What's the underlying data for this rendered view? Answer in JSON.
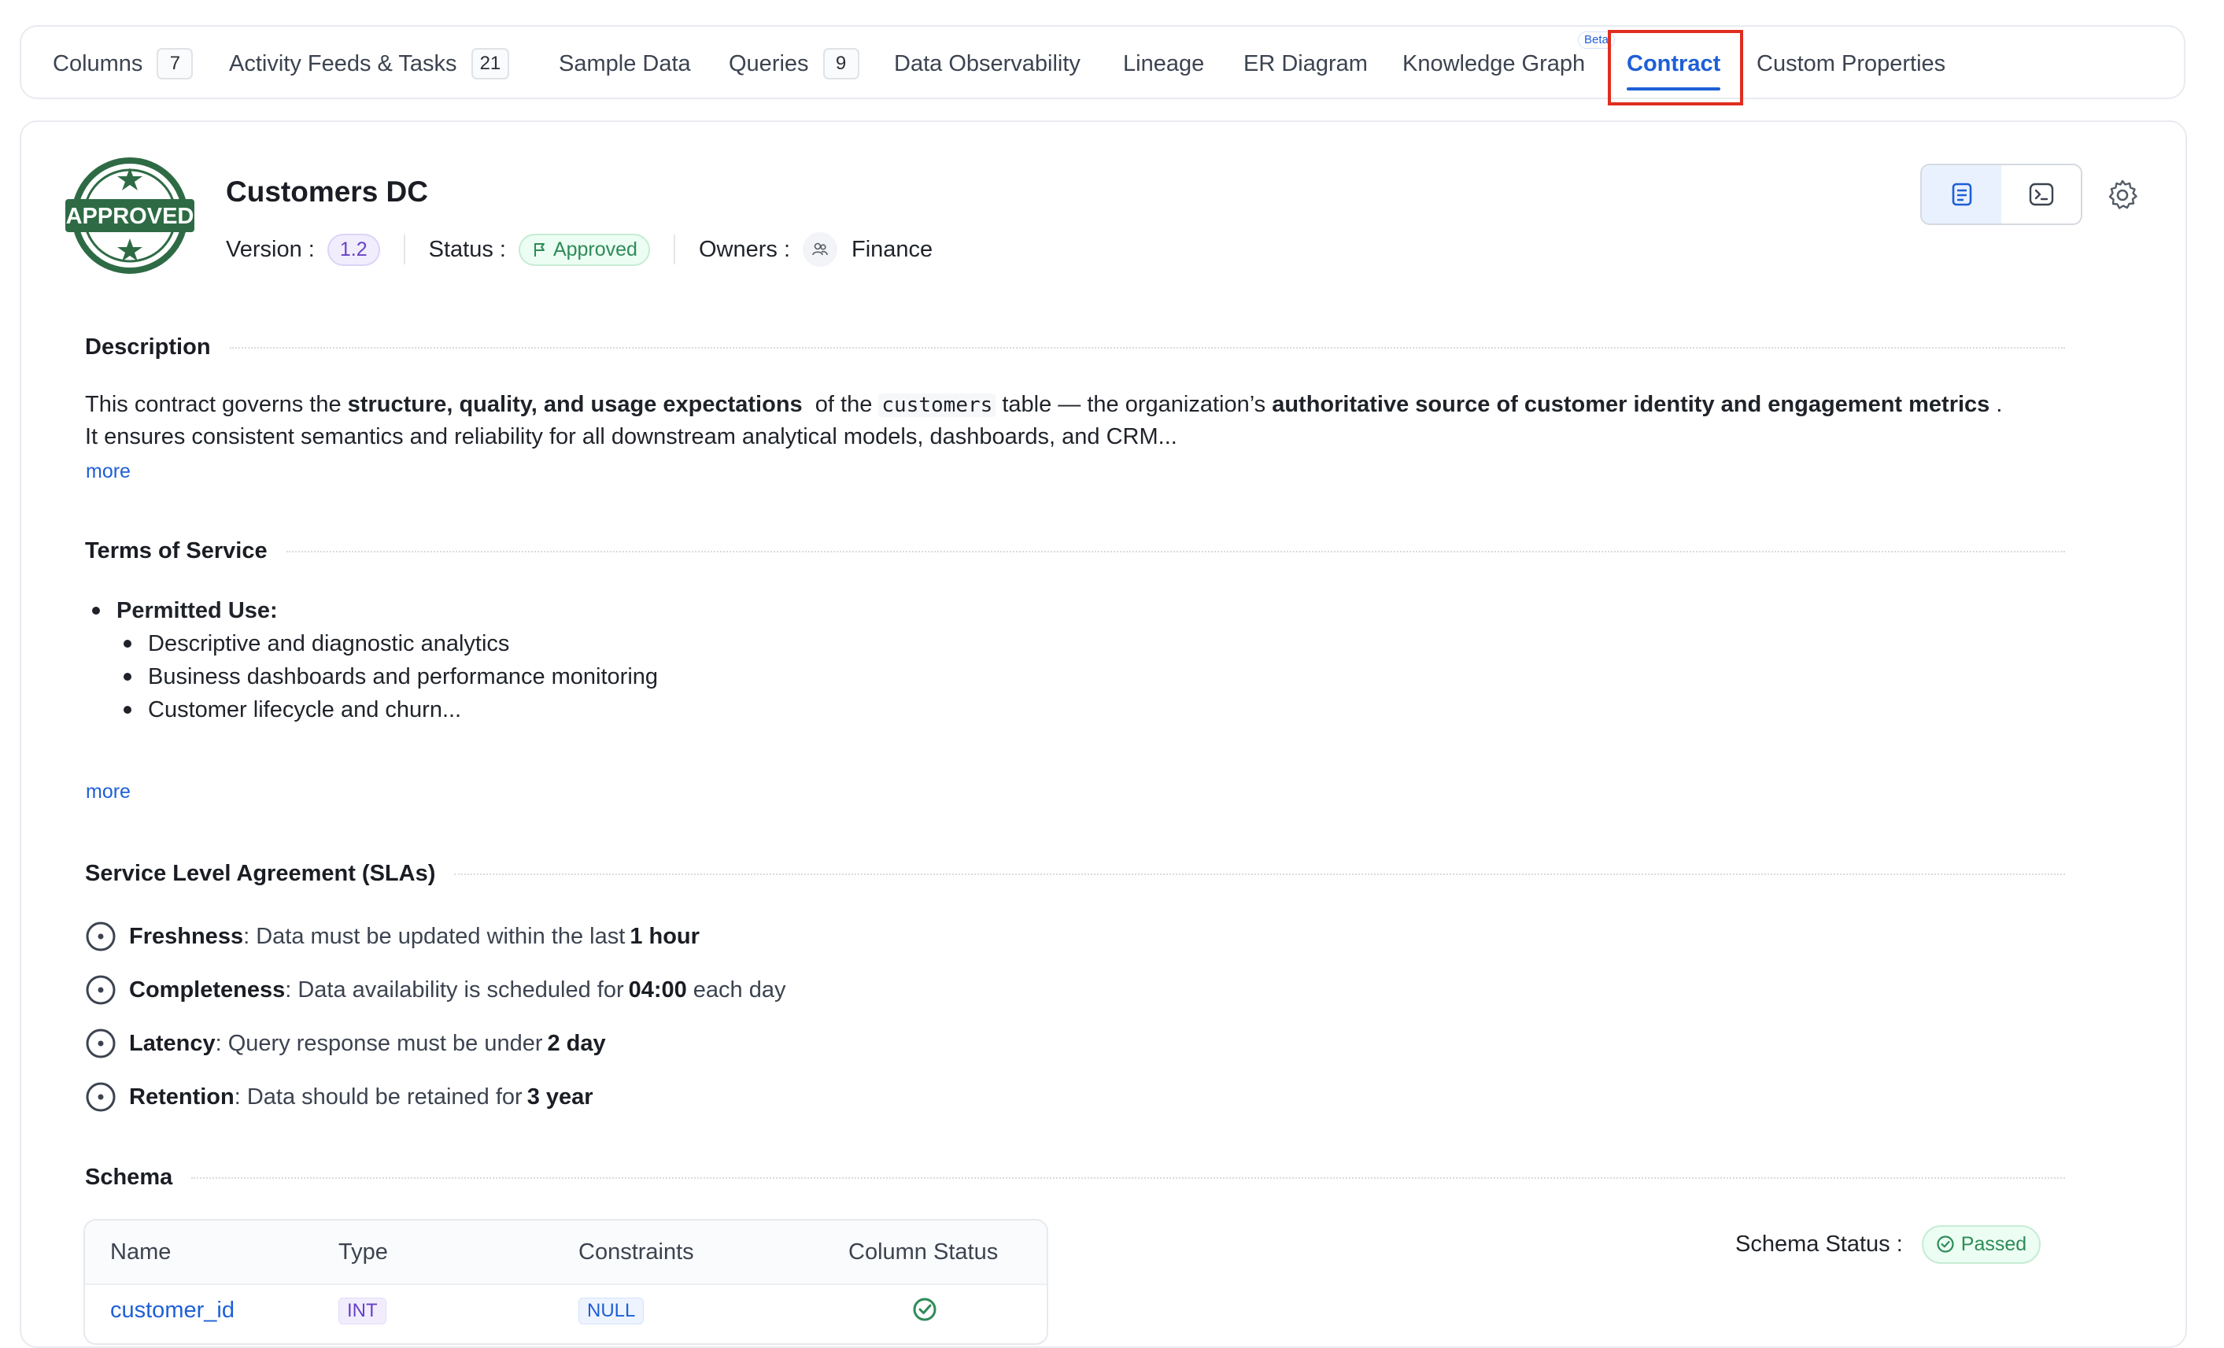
{
  "tabs": [
    {
      "label": "Columns",
      "count": "7"
    },
    {
      "label": "Activity Feeds & Tasks",
      "count": "21"
    },
    {
      "label": "Sample Data"
    },
    {
      "label": "Queries",
      "count": "9"
    },
    {
      "label": "Data Observability"
    },
    {
      "label": "Lineage"
    },
    {
      "label": "ER Diagram"
    },
    {
      "label": "Knowledge Graph",
      "badge": "Beta"
    },
    {
      "label": "Contract",
      "active": true
    },
    {
      "label": "Custom Properties"
    }
  ],
  "contract": {
    "badge_text": "APPROVED",
    "title": "Customers DC",
    "version_label": "Version :",
    "version": "1.2",
    "status_label": "Status :",
    "status": "Approved",
    "owners_label": "Owners :",
    "owner": "Finance"
  },
  "description": {
    "heading": "Description",
    "p1": "This contract governs the ",
    "b1": "structure, quality, and usage expectations",
    "p2": "  of the ",
    "code": "customers",
    "p3": " table — the organization’s ",
    "b2": "authoritative source of customer identity and engagement metrics",
    "p4": " .",
    "line2": "It ensures consistent semantics and reliability for all downstream analytical models, dashboards, and CRM...",
    "more": "more"
  },
  "terms": {
    "heading": "Terms of Service",
    "permitted": "Permitted Use:",
    "items": [
      "Descriptive and diagnostic analytics",
      "Business dashboards and performance monitoring",
      "Customer lifecycle and churn..."
    ],
    "more": "more"
  },
  "sla": {
    "heading": "Service Level Agreement (SLAs)",
    "items": [
      {
        "key": "Freshness",
        "text": ": Data must be updated within the last",
        "value": "1 hour",
        "tail": ""
      },
      {
        "key": "Completeness",
        "text": ": Data availability is scheduled for",
        "value": "04:00",
        "tail": "each day"
      },
      {
        "key": "Latency",
        "text": ": Query response must be under",
        "value": "2 day",
        "tail": ""
      },
      {
        "key": "Retention",
        "text": ": Data should be retained for",
        "value": "3 year",
        "tail": ""
      }
    ]
  },
  "schema": {
    "heading": "Schema",
    "columns": [
      "Name",
      "Type",
      "Constraints",
      "Column Status"
    ],
    "rows": [
      {
        "name": "customer_id",
        "type": "INT",
        "constraint": "NULL"
      }
    ],
    "status_label": "Schema Status :",
    "status": "Passed"
  },
  "colors": {
    "accent": "#1e5fd6",
    "approved_green": "#2e6b45",
    "highlight_red": "#e02d1f"
  }
}
